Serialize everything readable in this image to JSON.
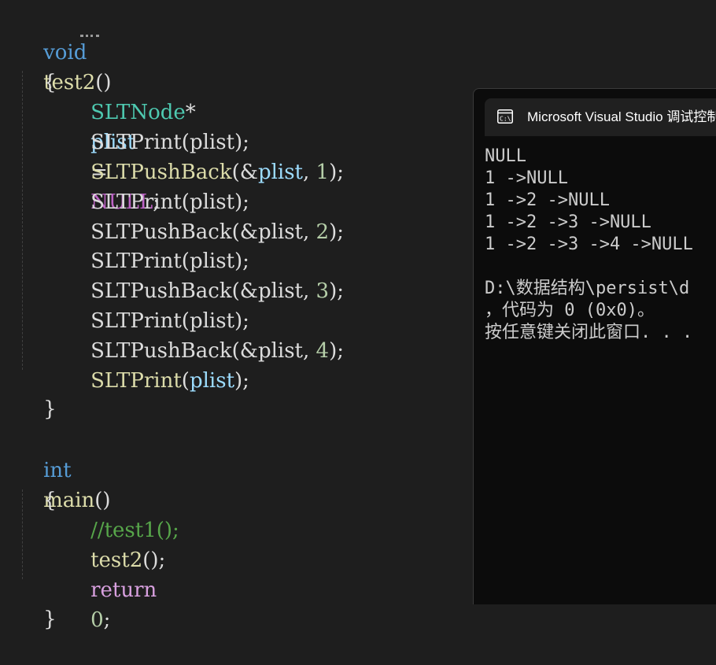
{
  "code": {
    "test2": {
      "void_kw": "void",
      "name": "test2",
      "parens": "()",
      "open_brace": "{",
      "close_brace": "}",
      "decl": {
        "type": "SLTNode",
        "star": "*",
        "var": "plist",
        "eq": "=",
        "init": "NULL",
        "semi": ";"
      },
      "print_fn": "SLTPrint",
      "push_fn": "SLTPushBack",
      "arg_var": "plist",
      "addr": "&",
      "values": [
        "1",
        "2",
        "3",
        "4"
      ]
    },
    "main": {
      "int_kw": "int",
      "name": "main",
      "parens": "()",
      "open_brace": "{",
      "close_brace": "}",
      "comment": "//test1();",
      "call": "test2",
      "return_kw": "return",
      "return_value": "0"
    }
  },
  "console": {
    "title": "Microsoft Visual Studio 调试控制台",
    "icon": "console-icon",
    "lines": [
      "NULL",
      "1 ->NULL",
      "1 ->2 ->NULL",
      "1 ->2 ->3 ->NULL",
      "1 ->2 ->3 ->4 ->NULL",
      "",
      "D:\\数据结构\\persist\\d",
      "，代码为 0 (0x0)。",
      "按任意键关闭此窗口. . ."
    ]
  },
  "colors": {
    "editor_bg": "#1e1e1e",
    "keyword": "#569cd6",
    "control_keyword": "#d8a0df",
    "type": "#4ec9b0",
    "function": "#dcdcaa",
    "variable": "#9cdcfe",
    "number": "#b5cea8",
    "comment": "#57a64a",
    "console_bg": "#0c0c0c"
  }
}
